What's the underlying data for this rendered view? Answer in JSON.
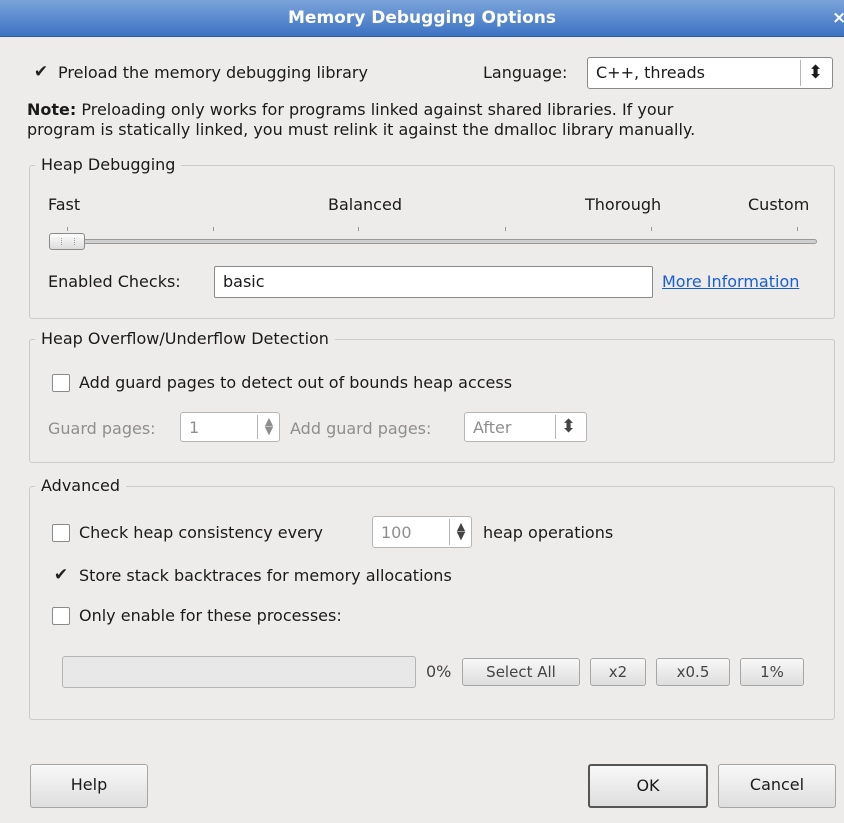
{
  "window": {
    "title": "Memory Debugging Options",
    "close_glyph": "×"
  },
  "preload": {
    "checked": "✔",
    "label": "Preload the memory debugging library"
  },
  "language": {
    "label": "Language:",
    "value": "C++, threads"
  },
  "note": {
    "bold": "Note:",
    "line1": " Preloading only works for programs linked against shared libraries. If your",
    "line2": "program is statically linked, you must relink it against the dmalloc library manually."
  },
  "heap_debugging": {
    "title": "Heap Debugging",
    "levels": [
      "Fast",
      "Balanced",
      "Thorough",
      "Custom"
    ],
    "slider_level": 0,
    "enabled_checks_label": "Enabled Checks:",
    "enabled_checks_value": "basic",
    "more_info": "More Information"
  },
  "overflow": {
    "title": "Heap Overflow/Underflow Detection",
    "guard_checkbox_label": "Add guard pages to detect out of bounds heap access",
    "guard_pages_label": "Guard pages:",
    "guard_pages_value": "1",
    "add_guard_label": "Add guard pages:",
    "add_guard_value": "After"
  },
  "advanced": {
    "title": "Advanced",
    "consistency_label": "Check heap consistency every",
    "consistency_value": "100",
    "consistency_suffix": "heap operations",
    "backtrace_checked": "✔",
    "backtrace_label": "Store stack backtraces for memory allocations",
    "only_enable_label": "Only enable for these processes:",
    "progress_text": "0%",
    "progress_value": 0,
    "buttons": [
      "Select All",
      "x2",
      "x0.5",
      "1%"
    ]
  },
  "footer": {
    "help": "Help",
    "ok": "OK",
    "cancel": "Cancel"
  },
  "icons": {
    "combo_arrows": "⬍",
    "spin_up": "▲",
    "spin_down": "▼"
  }
}
